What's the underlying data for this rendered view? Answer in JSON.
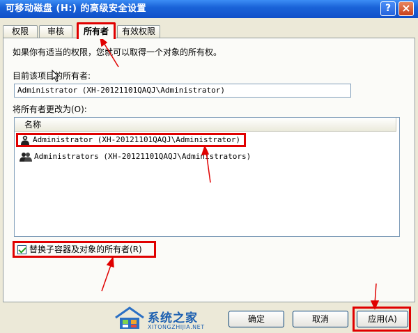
{
  "window": {
    "title": "可移动磁盘 (H:) 的高级安全设置",
    "help_label": "?",
    "close_label": "×"
  },
  "tabs": [
    {
      "label": "权限"
    },
    {
      "label": "审核"
    },
    {
      "label": "所有者"
    },
    {
      "label": "有效权限"
    }
  ],
  "owner": {
    "intro_text": "如果你有适当的权限，您就可以取得一个对象的所有权。",
    "current_label": "目前该项目的所有者:",
    "current_value": "Administrator (XH-20121101QAQJ\\Administrator)",
    "change_label": "将所有者更改为(O):",
    "column_header": "名称",
    "items": [
      {
        "name": "Administrator (XH-20121101QAQJ\\Administrator)"
      },
      {
        "name": "Administrators (XH-20121101QAQJ\\Administrators)"
      }
    ],
    "replace_label": "替换子容器及对象的所有者(R)"
  },
  "buttons": {
    "ok": "确定",
    "cancel": "取消",
    "apply": "应用(A)"
  },
  "watermark": {
    "brand": "系统之家",
    "url": "XITONGZHIJIA.NET"
  },
  "colors": {
    "annotation_red": "#e00000",
    "title_blue": "#1a63d8"
  }
}
